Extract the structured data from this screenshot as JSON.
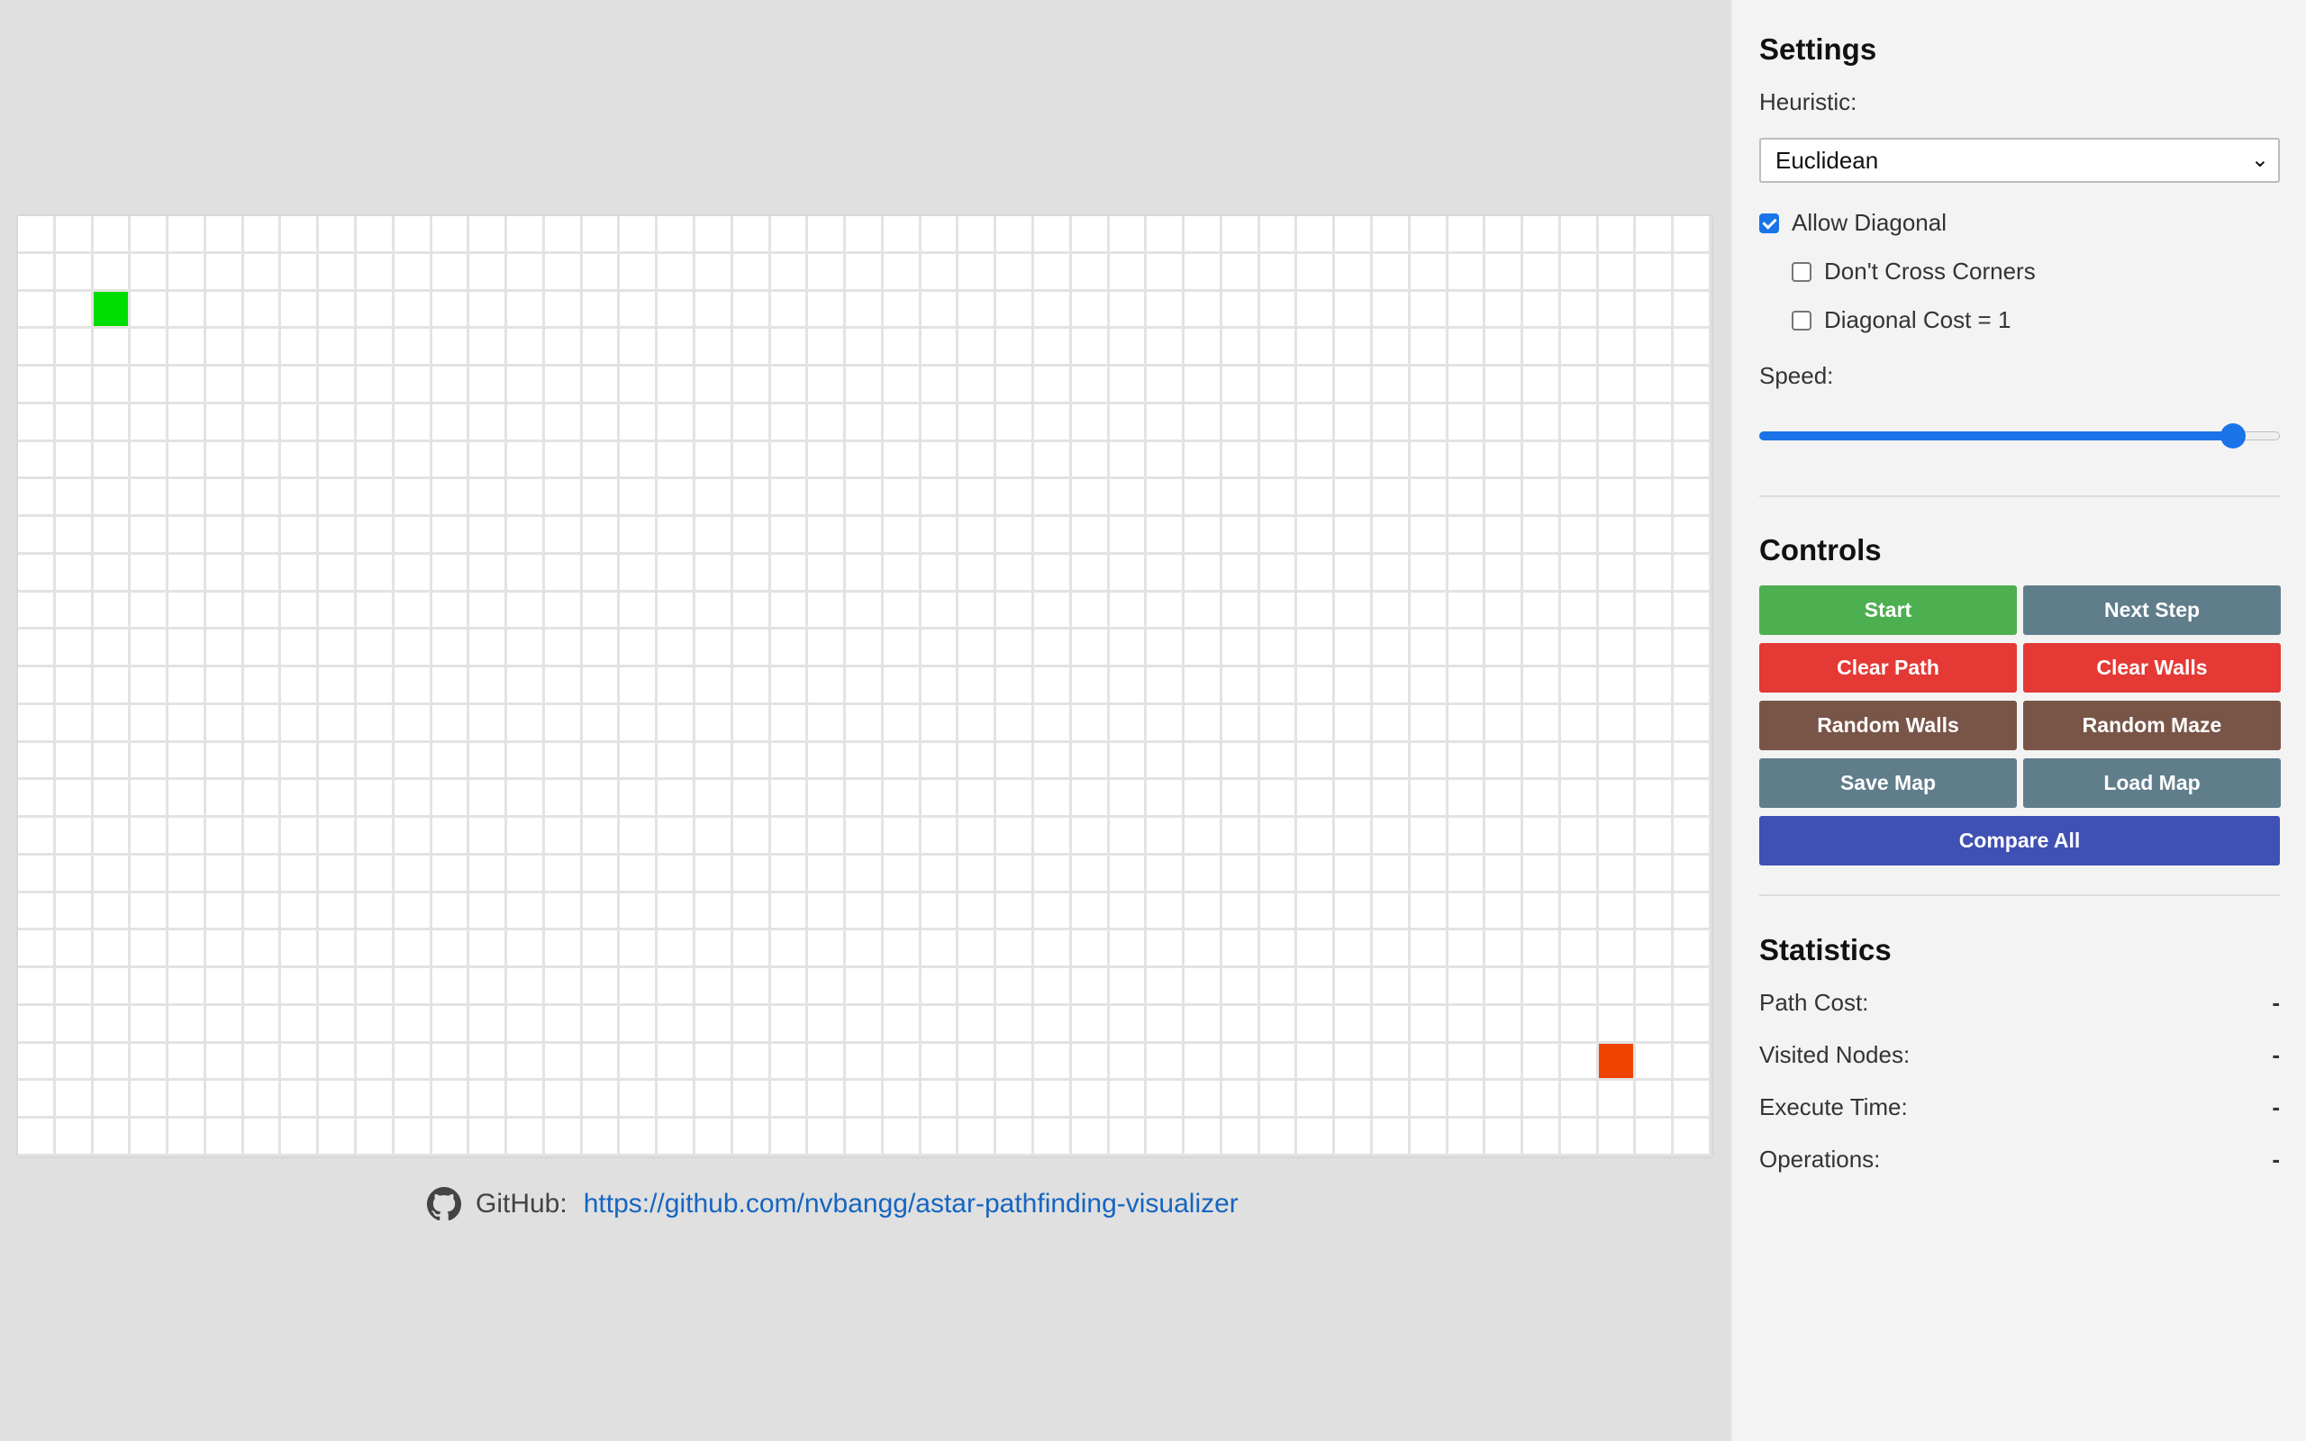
{
  "grid": {
    "columns": 45,
    "rows": 25,
    "start": {
      "row": 2,
      "col": 2
    },
    "end": {
      "row": 22,
      "col": 42
    }
  },
  "footer": {
    "github_label": "GitHub:",
    "github_link": "https://github.com/nvbangg/astar-pathfinding-visualizer"
  },
  "settings": {
    "title": "Settings",
    "heuristic_label": "Heuristic:",
    "heuristic_value": "Euclidean",
    "allow_diagonal": {
      "label": "Allow Diagonal",
      "checked": true
    },
    "dont_cross_corners": {
      "label": "Don't Cross Corners",
      "checked": false
    },
    "diagonal_cost": {
      "label": "Diagonal Cost = 1",
      "checked": false
    },
    "speed_label": "Speed:",
    "speed_fraction": 0.91
  },
  "controls": {
    "title": "Controls",
    "start": "Start",
    "next_step": "Next Step",
    "clear_path": "Clear Path",
    "clear_walls": "Clear Walls",
    "random_walls": "Random Walls",
    "random_maze": "Random Maze",
    "save_map": "Save Map",
    "load_map": "Load Map",
    "compare_all": "Compare All"
  },
  "statistics": {
    "title": "Statistics",
    "path_cost": {
      "label": "Path Cost:",
      "value": "-"
    },
    "visited_nodes": {
      "label": "Visited Nodes:",
      "value": "-"
    },
    "execute_time": {
      "label": "Execute Time:",
      "value": "-"
    },
    "operations": {
      "label": "Operations:",
      "value": "-"
    }
  },
  "colors": {
    "start_cell": "#00dd00",
    "end_cell": "#ee4400",
    "green": "#4caf50",
    "slate": "#607d8b",
    "red": "#e53935",
    "brown": "#795548",
    "indigo": "#3f51b5",
    "link": "#1565c0",
    "accent": "#1a73e8"
  }
}
